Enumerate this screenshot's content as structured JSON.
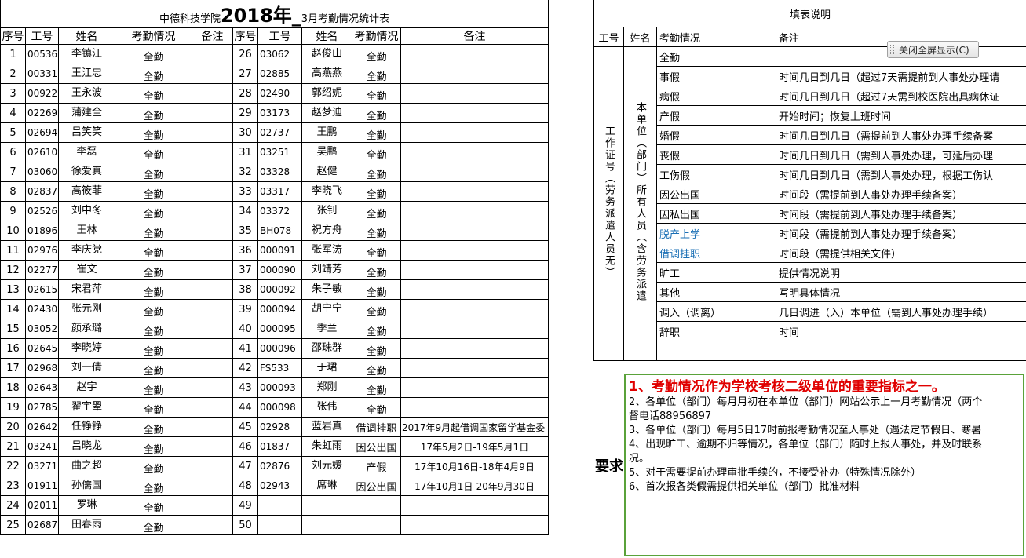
{
  "title": {
    "prefix": "中德科技学院",
    "bold": "2018年_",
    "suffix": "3月考勤情况统计表"
  },
  "headers": {
    "seq": "序号",
    "id": "工号",
    "name": "姓名",
    "status": "考勤情况",
    "note": "备注"
  },
  "left_rows": [
    {
      "seq": "1",
      "id": "00536",
      "name": "李镇江",
      "status": "全勤"
    },
    {
      "seq": "2",
      "id": "00331",
      "name": "王江忠",
      "status": "全勤"
    },
    {
      "seq": "3",
      "id": "00922",
      "name": "王永波",
      "status": "全勤"
    },
    {
      "seq": "4",
      "id": "02269",
      "name": "蒲建全",
      "status": "全勤"
    },
    {
      "seq": "5",
      "id": "02694",
      "name": "吕笑笑",
      "status": "全勤"
    },
    {
      "seq": "6",
      "id": "02610",
      "name": "李磊",
      "status": "全勤"
    },
    {
      "seq": "7",
      "id": "03060",
      "name": "徐爱真",
      "status": "全勤"
    },
    {
      "seq": "8",
      "id": "02837",
      "name": "高筱菲",
      "status": "全勤"
    },
    {
      "seq": "9",
      "id": "02526",
      "name": "刘中冬",
      "status": "全勤"
    },
    {
      "seq": "10",
      "id": "01896",
      "name": "王林",
      "status": "全勤"
    },
    {
      "seq": "11",
      "id": "02976",
      "name": "李庆党",
      "status": "全勤"
    },
    {
      "seq": "12",
      "id": "02277",
      "name": "崔文",
      "status": "全勤"
    },
    {
      "seq": "13",
      "id": "02615",
      "name": "宋君萍",
      "status": "全勤"
    },
    {
      "seq": "14",
      "id": "02430",
      "name": "张元刚",
      "status": "全勤"
    },
    {
      "seq": "15",
      "id": "03052",
      "name": "颜承璐",
      "status": "全勤"
    },
    {
      "seq": "16",
      "id": "02645",
      "name": "李晓婷",
      "status": "全勤"
    },
    {
      "seq": "17",
      "id": "02968",
      "name": "刘一倩",
      "status": "全勤"
    },
    {
      "seq": "18",
      "id": "02643",
      "name": "赵宇",
      "status": "全勤"
    },
    {
      "seq": "19",
      "id": "02785",
      "name": "翟宇翚",
      "status": "全勤"
    },
    {
      "seq": "20",
      "id": "02642",
      "name": "任铮铮",
      "status": "全勤"
    },
    {
      "seq": "21",
      "id": "03241",
      "name": "吕晓龙",
      "status": "全勤"
    },
    {
      "seq": "22",
      "id": "03271",
      "name": "曲之超",
      "status": "全勤"
    },
    {
      "seq": "23",
      "id": "01911",
      "name": "孙儒国",
      "status": "全勤"
    },
    {
      "seq": "24",
      "id": "02011",
      "name": "罗琳",
      "status": "全勤"
    },
    {
      "seq": "25",
      "id": "02687",
      "name": "田春雨",
      "status": "全勤"
    }
  ],
  "right_rows": [
    {
      "seq": "26",
      "id": "03062",
      "name": "赵俊山",
      "status": "全勤",
      "note": ""
    },
    {
      "seq": "27",
      "id": "02885",
      "name": "高燕燕",
      "status": "全勤",
      "note": ""
    },
    {
      "seq": "28",
      "id": "02490",
      "name": "郭绍妮",
      "status": "全勤",
      "note": ""
    },
    {
      "seq": "29",
      "id": "03173",
      "name": "赵梦迪",
      "status": "全勤",
      "note": ""
    },
    {
      "seq": "30",
      "id": "02737",
      "name": "王鹏",
      "status": "全勤",
      "note": ""
    },
    {
      "seq": "31",
      "id": "03251",
      "name": "吴鹏",
      "status": "全勤",
      "note": ""
    },
    {
      "seq": "32",
      "id": "03328",
      "name": "赵健",
      "status": "全勤",
      "note": ""
    },
    {
      "seq": "33",
      "id": "03317",
      "name": "李晓飞",
      "status": "全勤",
      "note": ""
    },
    {
      "seq": "34",
      "id": "03372",
      "name": "张钊",
      "status": "全勤",
      "note": ""
    },
    {
      "seq": "35",
      "id": "BH078",
      "name": "祝方舟",
      "status": "全勤",
      "note": ""
    },
    {
      "seq": "36",
      "id": "000091",
      "name": "张军涛",
      "status": "全勤",
      "note": ""
    },
    {
      "seq": "37",
      "id": "000090",
      "name": "刘靖芳",
      "status": "全勤",
      "note": ""
    },
    {
      "seq": "38",
      "id": "000092",
      "name": "朱子敏",
      "status": "全勤",
      "note": ""
    },
    {
      "seq": "39",
      "id": "000094",
      "name": "胡宁宁",
      "status": "全勤",
      "note": ""
    },
    {
      "seq": "40",
      "id": "000095",
      "name": "季兰",
      "status": "全勤",
      "note": ""
    },
    {
      "seq": "41",
      "id": "000096",
      "name": "邵珠群",
      "status": "全勤",
      "note": ""
    },
    {
      "seq": "42",
      "id": "FS533",
      "name": "于珺",
      "status": "全勤",
      "note": ""
    },
    {
      "seq": "43",
      "id": "000093",
      "name": "郑刚",
      "status": "全勤",
      "note": ""
    },
    {
      "seq": "44",
      "id": "000098",
      "name": "张伟",
      "status": "全勤",
      "note": ""
    },
    {
      "seq": "45",
      "id": "02928",
      "name": "蓝岩真",
      "status": "借调挂职",
      "note": "2017年9月起借调国家留学基金委"
    },
    {
      "seq": "46",
      "id": "01837",
      "name": "朱虹雨",
      "status": "因公出国",
      "note": "17年5月2日-19年5月1日"
    },
    {
      "seq": "47",
      "id": "02876",
      "name": "刘元媛",
      "status": "产假",
      "note": "17年10月16日-18年4月9日"
    },
    {
      "seq": "48",
      "id": "02943",
      "name": "席琳",
      "status": "因公出国",
      "note": "17年10月1日-20年9月30日"
    },
    {
      "seq": "49",
      "id": "",
      "name": "",
      "status": "",
      "note": ""
    },
    {
      "seq": "50",
      "id": "",
      "name": "",
      "status": "",
      "note": ""
    }
  ],
  "legend": {
    "title": "填表说明",
    "headers": {
      "id": "工号",
      "name": "姓名",
      "status": "考勤情况",
      "note": "备注"
    },
    "id_vertical": "工作证号（劳务派遣人员无）",
    "name_vertical": "本单位（部门）所有人员（含劳务派遣",
    "rows": [
      {
        "type": "全勤",
        "desc": ""
      },
      {
        "type": "事假",
        "desc": "时间几日到几日（超过7天需提前到人事处办理请"
      },
      {
        "type": "病假",
        "desc": "时间几日到几日（超过7天需到校医院出具病休证"
      },
      {
        "type": "产假",
        "desc": "开始时间；恢复上班时间"
      },
      {
        "type": "婚假",
        "desc": "时间几日到几日（需提前到人事处办理手续备案"
      },
      {
        "type": "丧假",
        "desc": "时间几日到几日（需到人事处办理，可延后办理"
      },
      {
        "type": "工伤假",
        "desc": "时间几日到几日（需到人事处办理，根据工伤认"
      },
      {
        "type": "因公出国",
        "desc": "时间段（需提前到人事处办理手续备案）"
      },
      {
        "type": "因私出国",
        "desc": "时间段（需提前到人事处办理手续备案）"
      },
      {
        "type": "脱产上学",
        "desc": "时间段（需提前到人事处办理手续备案）",
        "link": true
      },
      {
        "type": "借调挂职",
        "desc": "时间段（需提供相关文件）",
        "link": true
      },
      {
        "type": "旷工",
        "desc": "提供情况说明"
      },
      {
        "type": "其他",
        "desc": "写明具体情况"
      },
      {
        "type": "调入（调离）",
        "desc": "几日调进（入）本单位（需到人事处办理手续）"
      },
      {
        "type": "辞职",
        "desc": "时间"
      }
    ]
  },
  "requirements": {
    "label": "要求",
    "items": [
      "1、考勤情况作为学校考核二级单位的重要指标之一。",
      "2、各单位（部门）每月月初在本单位（部门）网站公示上一月考勤情况（两个",
      "督电话88956897",
      "3、各单位（部门）每月5日17时前报考勤情况至人事处（遇法定节假日、寒暑",
      "4、出现旷工、逾期不归等情况，各单位（部门）随时上报人事处，并及时联系",
      "况。",
      "5、对于需要提前办理审批手续的，不接受补办（特殊情况除外）",
      "6、首次报各类假需提供相关单位（部门）批准材料"
    ]
  },
  "exit_button": {
    "label": "关闭全屏显示(C)"
  }
}
